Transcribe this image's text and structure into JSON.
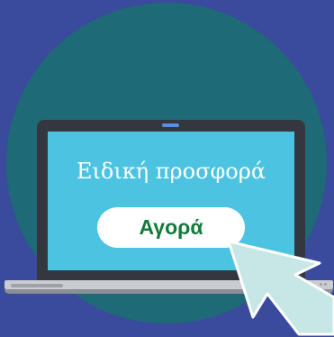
{
  "promo": {
    "title": "Ειδική προσφορά",
    "buy_label": "Αγορά"
  },
  "colors": {
    "background": "#3a4a9c",
    "circle": "#1f6a77",
    "screen": "#4dc3e2",
    "bezel": "#34383e",
    "button_text": "#137a3b",
    "cursor_fill": "#c7e6e6"
  },
  "icons": {
    "pointer": "mouse-pointer-icon",
    "camera": "webcam-icon"
  }
}
